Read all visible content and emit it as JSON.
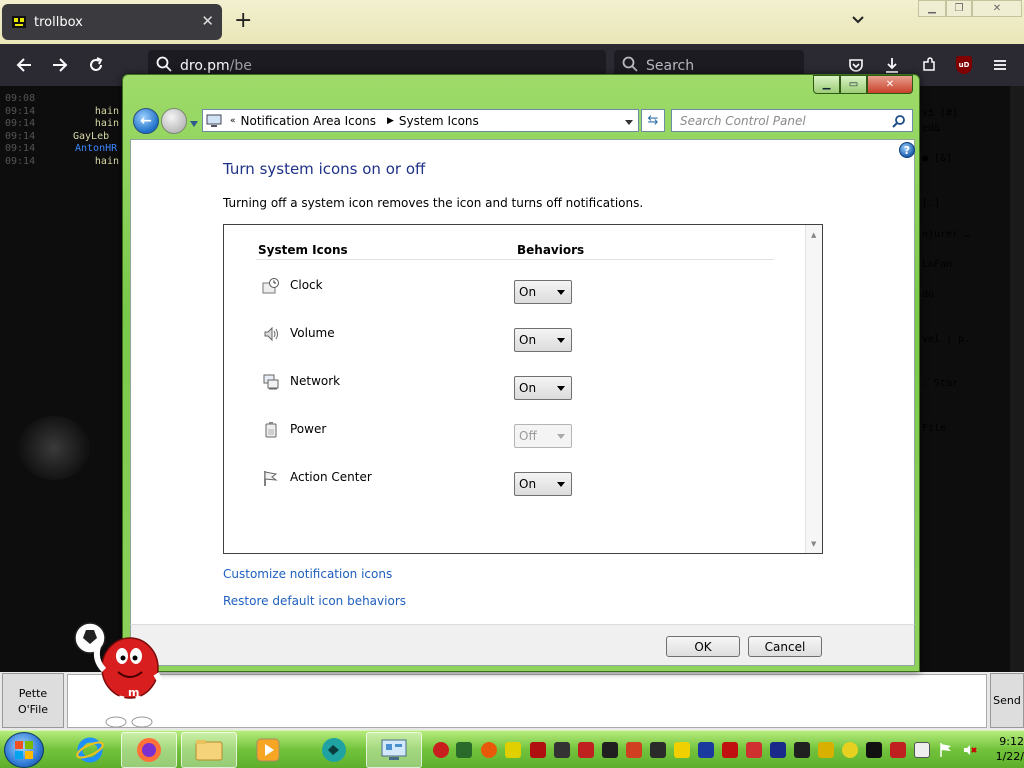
{
  "browser": {
    "tab": {
      "title": "trollbox"
    },
    "url": {
      "host": "dro.pm",
      "path": "/be"
    },
    "search_placeholder": "Search",
    "ublock_badge": "uD"
  },
  "chat": {
    "lines": [
      {
        "time": "09:08",
        "user": "",
        "color": "#666666"
      },
      {
        "time": "09:14",
        "user": "hain",
        "color": "#d9d9a6"
      },
      {
        "time": "09:14",
        "user": "hain",
        "color": "#d9d9a6"
      },
      {
        "time": "09:14",
        "user": "GayLeb",
        "color": "#d9d9a6"
      },
      {
        "time": "09:14",
        "user": "AntonHR",
        "color": "#3b86ff"
      },
      {
        "time": "09:14",
        "user": "hain",
        "color": "#d9d9a6"
      }
    ],
    "right_fragments": [
      {
        "text": "v5 [#]",
        "color": "#e8a23a"
      },
      {
        "text": "ed&",
        "color": "#6fbf3a"
      },
      {
        "text": "● [&]",
        "color": "#ffffff"
      },
      {
        "text": "[.]",
        "color": "#e8a23a"
      },
      {
        "text": "njurer …",
        "color": "#3b86ff"
      },
      {
        "text": "LoFan",
        "color": "#6fbf3a"
      },
      {
        "text": "do",
        "color": "#dddddd"
      },
      {
        "text": "vel | p.",
        "color": "#dd44dd"
      },
      {
        "text": ": Star",
        "color": "#dddddd"
      },
      {
        "text": "File",
        "color": "#3fbf3f"
      }
    ],
    "user_button": "Pette O'File",
    "send_button": "Send"
  },
  "dialog": {
    "breadcrumb": [
      "Notification Area Icons",
      "System Icons"
    ],
    "search_placeholder": "Search Control Panel",
    "title": "Turn system icons on or off",
    "description": "Turning off a system icon removes the icon and turns off notifications.",
    "columns": {
      "icons": "System Icons",
      "behaviors": "Behaviors"
    },
    "rows": [
      {
        "label": "Clock",
        "value": "On",
        "disabled": false
      },
      {
        "label": "Volume",
        "value": "On",
        "disabled": false
      },
      {
        "label": "Network",
        "value": "On",
        "disabled": false
      },
      {
        "label": "Power",
        "value": "Off",
        "disabled": true
      },
      {
        "label": "Action Center",
        "value": "On",
        "disabled": false
      }
    ],
    "links": {
      "customize": "Customize notification icons",
      "restore": "Restore default icon behaviors"
    },
    "buttons": {
      "ok": "OK",
      "cancel": "Cancel"
    }
  },
  "taskbar": {
    "clock_time": "9:12",
    "clock_date": "1/22/"
  }
}
